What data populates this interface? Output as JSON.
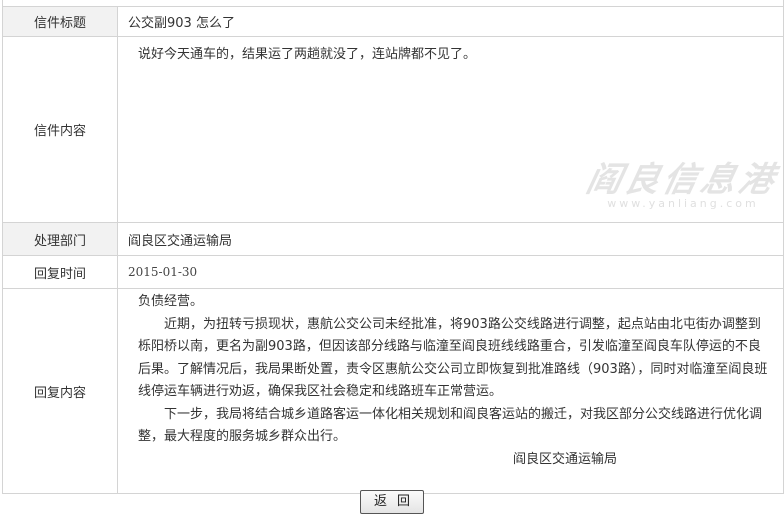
{
  "letter": {
    "title_label": "信件标题",
    "title": "公交副903 怎么了",
    "content_label": "信件内容",
    "content": "说好今天通车的，结果运了两趟就没了，连站牌都不见了。",
    "dept_label": "处理部门",
    "dept": "阎良区交通运输局",
    "time_label": "回复时间",
    "time": "2015-01-30",
    "reply_label": "回复内容",
    "reply": {
      "p1": "负债经营。",
      "p2": "近期，为扭转亏损现状，惠航公交公司未经批准，将903路公交线路进行调整，起点站由北屯街办调整到栎阳桥以南，更名为副903路，但因该部分线路与临潼至阎良班线线路重合，引发临潼至阎良车队停运的不良后果。了解情况后，我局果断处置，责令区惠航公交公司立即恢复到批准路线（903路），同时对临潼至阎良班线停运车辆进行劝返，确保我区社会稳定和线路班车正常营运。",
      "p3": "下一步，我局将结合城乡道路客运一体化相关规划和阎良客运站的搬迁，对我区部分公交线路进行优化调整，最大程度的服务城乡群众出行。",
      "signature": "阎良区交通运输局"
    }
  },
  "watermark": {
    "main": "阎良信息港",
    "sub": "www.yanliang.com"
  },
  "back_button": "返回"
}
